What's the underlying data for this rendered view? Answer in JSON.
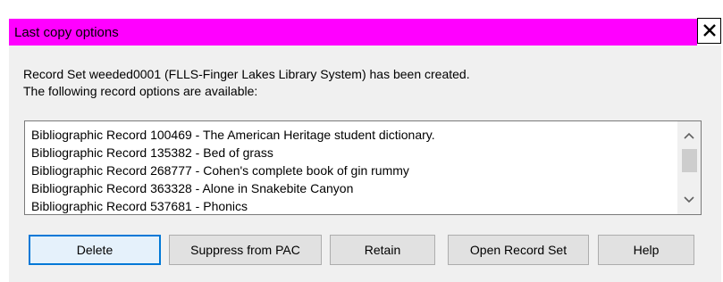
{
  "dialog": {
    "title": "Last copy options",
    "close_glyph": "✕"
  },
  "message": {
    "line1": "Record Set weeded0001 (FLLS-Finger Lakes Library System) has been created.",
    "line2": "The following record options are available:"
  },
  "records": [
    "Bibliographic Record 100469 - The American Heritage student dictionary.",
    "Bibliographic Record 135382 - Bed of grass",
    "Bibliographic Record 268777 - Cohen's complete book of gin rummy",
    "Bibliographic Record 363328 - Alone in Snakebite Canyon",
    "Bibliographic Record 537681 - Phonics"
  ],
  "buttons": {
    "delete": "Delete",
    "suppress": "Suppress from PAC",
    "retain": "Retain",
    "open_record_set": "Open Record Set",
    "help": "Help"
  },
  "colors": {
    "title_bar": "#ff00ff",
    "dialog_body": "#f0f0f0",
    "default_button_border": "#0078d7"
  },
  "icons": {
    "close": "close-icon",
    "scroll_up": "chevron-up-icon",
    "scroll_down": "chevron-down-icon"
  }
}
